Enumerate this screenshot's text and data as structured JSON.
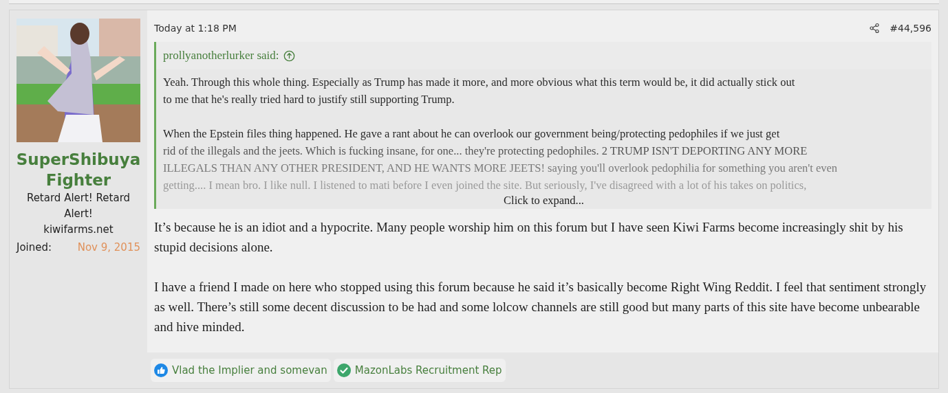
{
  "user": {
    "name": "SuperShibuyaFighter",
    "title": "Retard Alert! Retard Alert!",
    "banner": "kiwifarms.net",
    "joined_label": "Joined:",
    "joined_value": "Nov 9, 2015"
  },
  "post": {
    "time": "Today at 1:18 PM",
    "number": "#44,596",
    "quote": {
      "author": "prollyanotherlurker said:",
      "paragraphs": [
        [
          "Yeah. Through this whole thing. Especially as Trump has made it more, and more obvious what this term would be, it did actually stick out",
          "to me that he's really tried hard to justify still supporting Trump."
        ],
        [
          "When the Epstein files thing happened. He gave a rant about he can overlook our government being/protecting pedophiles if we just get",
          "rid of the illegals and the jeets. Which is fucking insane, for one... they're protecting pedophiles. 2 TRUMP ISN'T DEPORTING ANY MORE",
          "ILLEGALS THAN ANY OTHER PRESIDENT, AND HE WANTS MORE JEETS! saying you'll overlook pedophilia for something you aren't even",
          "getting.... I mean bro. I like null. I listened to mati before I even joined the site. But seriously, I've disagreed with a lot of his takes on politics,"
        ]
      ],
      "expand": "Click to expand..."
    },
    "body": [
      "It’s because he is an idiot and a hypocrite. Many people worship him on this forum but I have seen Kiwi Farms become increasingly shit by his stupid decisions alone.",
      "I have a friend I made on here who stopped using this forum because he said it’s basically become Right Wing Reddit. I feel that sentiment strongly as well. There’s still some decent discussion to be had and some lolcow channels are still good but many parts of this site have become unbearable and hive minded."
    ],
    "reactions": [
      {
        "kind": "like",
        "text": "Vlad the Implier and somevan"
      },
      {
        "kind": "check",
        "text": "MazonLabs Recruitment Rep"
      }
    ]
  }
}
